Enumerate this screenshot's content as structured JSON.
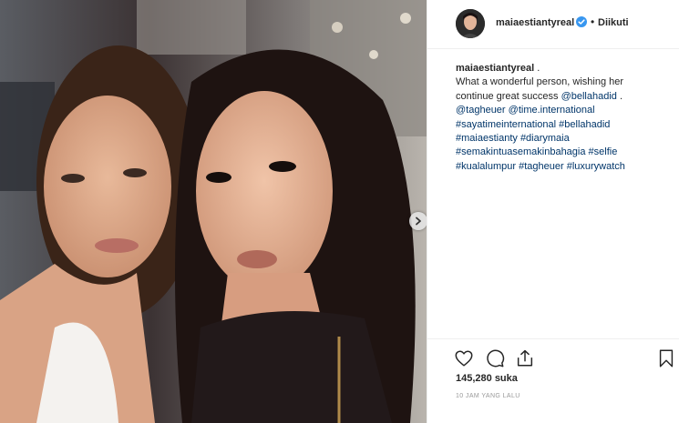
{
  "post": {
    "photo_alt": "selfie-photo",
    "next_icon": "chevron-right-icon"
  },
  "header": {
    "username": "maiaestiantyreal",
    "verified_icon": "verified-badge-icon",
    "separator": "•",
    "follow_status": "Diikuti"
  },
  "caption": {
    "username": "maiaestiantyreal",
    "after_username": " .",
    "lines": [
      {
        "t1": "What a wonderful person, wishing her",
        "l1": ""
      },
      {
        "t1": "continue great success ",
        "l1": "@bellahadid",
        "t2": " ."
      },
      {
        "l1": "@tagheuer",
        "t1": " ",
        "l2": "@time.international"
      },
      {
        "l1": "#sayatimeinternational",
        "t1": " ",
        "l2": "#bellahadid"
      },
      {
        "l1": "#maiaestianty",
        "t1": " ",
        "l2": "#diarymaia"
      },
      {
        "l1": "#semakintuasemakinbahagia",
        "t1": " ",
        "l2": "#selfie"
      },
      {
        "l1": "#kualalumpur",
        "t1": " ",
        "l2": "#tagheuer",
        "t2": " ",
        "l3": "#luxurywatch"
      }
    ]
  },
  "actions": {
    "like_icon": "heart-icon",
    "comment_icon": "comment-icon",
    "share_icon": "share-icon",
    "save_icon": "bookmark-icon",
    "likes": "145,280 suka",
    "timestamp": "10 JAM YANG LALU"
  },
  "colors": {
    "link": "#003569",
    "verified": "#3897f0",
    "border": "#efefef"
  }
}
